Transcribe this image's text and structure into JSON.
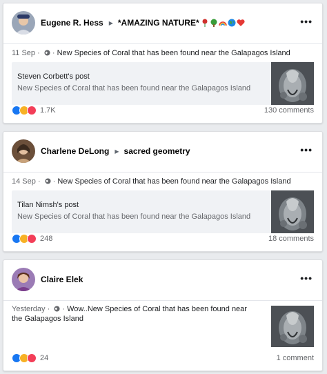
{
  "posts": [
    {
      "author": "Eugene R. Hess",
      "group": "*AMAZING NATURE*",
      "group_emojis": [
        "rose-icon",
        "tree-icon",
        "rainbow-icon",
        "globe-emoji-icon",
        "heart-icon"
      ],
      "date": "11 Sep",
      "description": "New Species of Coral that has been found near the Galapagos Island",
      "shared_from": "Steven Corbett's post",
      "shared_text": "New Species of Coral that has been found near the Galapagos Island",
      "reactions": [
        "like",
        "wow",
        "love"
      ],
      "reaction_count": "1.7K",
      "comments": "130 comments"
    },
    {
      "author": "Charlene DeLong",
      "group": "sacred geometry",
      "date": "14 Sep",
      "description": "New Species of Coral that has been found near the Galapagos Island",
      "shared_from": "Tilan Nimsh's post",
      "shared_text": "New Species of Coral that has been found near the Galapagos Island",
      "reactions": [
        "like",
        "wow",
        "love"
      ],
      "reaction_count": "248",
      "comments": "18 comments"
    },
    {
      "author": "Claire Elek",
      "date": "Yesterday",
      "description": "Wow..New Species of Coral that has been found near the Galapagos Island",
      "reactions": [
        "like",
        "wow",
        "love"
      ],
      "reaction_count": "24",
      "comments": "1 comment"
    }
  ],
  "colors": {
    "like": "#1877f2",
    "wow": "#f7b125",
    "love": "#f33e58",
    "share_bg": "#f0f2f5"
  },
  "separators": {
    "dot": "·"
  },
  "menu_icon": "more-options-icon"
}
